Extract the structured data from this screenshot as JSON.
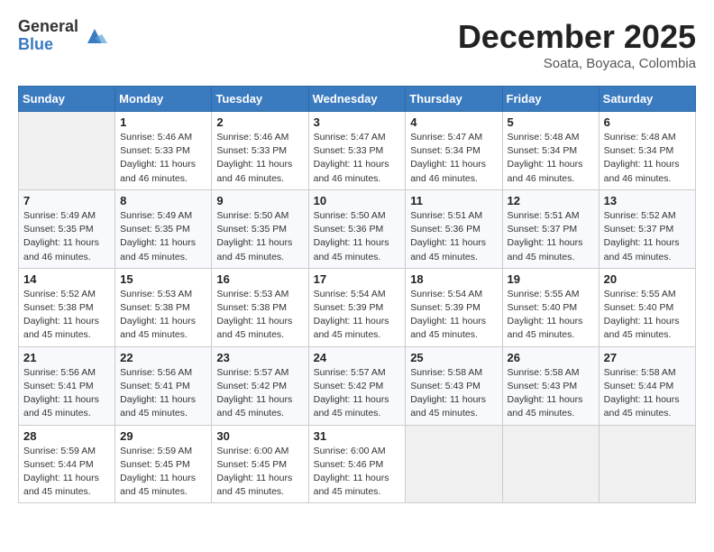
{
  "header": {
    "logo_general": "General",
    "logo_blue": "Blue",
    "month_title": "December 2025",
    "location": "Soata, Boyaca, Colombia"
  },
  "calendar": {
    "weekdays": [
      "Sunday",
      "Monday",
      "Tuesday",
      "Wednesday",
      "Thursday",
      "Friday",
      "Saturday"
    ],
    "weeks": [
      [
        {
          "day": "",
          "info": ""
        },
        {
          "day": "1",
          "info": "Sunrise: 5:46 AM\nSunset: 5:33 PM\nDaylight: 11 hours\nand 46 minutes."
        },
        {
          "day": "2",
          "info": "Sunrise: 5:46 AM\nSunset: 5:33 PM\nDaylight: 11 hours\nand 46 minutes."
        },
        {
          "day": "3",
          "info": "Sunrise: 5:47 AM\nSunset: 5:33 PM\nDaylight: 11 hours\nand 46 minutes."
        },
        {
          "day": "4",
          "info": "Sunrise: 5:47 AM\nSunset: 5:34 PM\nDaylight: 11 hours\nand 46 minutes."
        },
        {
          "day": "5",
          "info": "Sunrise: 5:48 AM\nSunset: 5:34 PM\nDaylight: 11 hours\nand 46 minutes."
        },
        {
          "day": "6",
          "info": "Sunrise: 5:48 AM\nSunset: 5:34 PM\nDaylight: 11 hours\nand 46 minutes."
        }
      ],
      [
        {
          "day": "7",
          "info": "Sunrise: 5:49 AM\nSunset: 5:35 PM\nDaylight: 11 hours\nand 46 minutes."
        },
        {
          "day": "8",
          "info": "Sunrise: 5:49 AM\nSunset: 5:35 PM\nDaylight: 11 hours\nand 45 minutes."
        },
        {
          "day": "9",
          "info": "Sunrise: 5:50 AM\nSunset: 5:35 PM\nDaylight: 11 hours\nand 45 minutes."
        },
        {
          "day": "10",
          "info": "Sunrise: 5:50 AM\nSunset: 5:36 PM\nDaylight: 11 hours\nand 45 minutes."
        },
        {
          "day": "11",
          "info": "Sunrise: 5:51 AM\nSunset: 5:36 PM\nDaylight: 11 hours\nand 45 minutes."
        },
        {
          "day": "12",
          "info": "Sunrise: 5:51 AM\nSunset: 5:37 PM\nDaylight: 11 hours\nand 45 minutes."
        },
        {
          "day": "13",
          "info": "Sunrise: 5:52 AM\nSunset: 5:37 PM\nDaylight: 11 hours\nand 45 minutes."
        }
      ],
      [
        {
          "day": "14",
          "info": "Sunrise: 5:52 AM\nSunset: 5:38 PM\nDaylight: 11 hours\nand 45 minutes."
        },
        {
          "day": "15",
          "info": "Sunrise: 5:53 AM\nSunset: 5:38 PM\nDaylight: 11 hours\nand 45 minutes."
        },
        {
          "day": "16",
          "info": "Sunrise: 5:53 AM\nSunset: 5:38 PM\nDaylight: 11 hours\nand 45 minutes."
        },
        {
          "day": "17",
          "info": "Sunrise: 5:54 AM\nSunset: 5:39 PM\nDaylight: 11 hours\nand 45 minutes."
        },
        {
          "day": "18",
          "info": "Sunrise: 5:54 AM\nSunset: 5:39 PM\nDaylight: 11 hours\nand 45 minutes."
        },
        {
          "day": "19",
          "info": "Sunrise: 5:55 AM\nSunset: 5:40 PM\nDaylight: 11 hours\nand 45 minutes."
        },
        {
          "day": "20",
          "info": "Sunrise: 5:55 AM\nSunset: 5:40 PM\nDaylight: 11 hours\nand 45 minutes."
        }
      ],
      [
        {
          "day": "21",
          "info": "Sunrise: 5:56 AM\nSunset: 5:41 PM\nDaylight: 11 hours\nand 45 minutes."
        },
        {
          "day": "22",
          "info": "Sunrise: 5:56 AM\nSunset: 5:41 PM\nDaylight: 11 hours\nand 45 minutes."
        },
        {
          "day": "23",
          "info": "Sunrise: 5:57 AM\nSunset: 5:42 PM\nDaylight: 11 hours\nand 45 minutes."
        },
        {
          "day": "24",
          "info": "Sunrise: 5:57 AM\nSunset: 5:42 PM\nDaylight: 11 hours\nand 45 minutes."
        },
        {
          "day": "25",
          "info": "Sunrise: 5:58 AM\nSunset: 5:43 PM\nDaylight: 11 hours\nand 45 minutes."
        },
        {
          "day": "26",
          "info": "Sunrise: 5:58 AM\nSunset: 5:43 PM\nDaylight: 11 hours\nand 45 minutes."
        },
        {
          "day": "27",
          "info": "Sunrise: 5:58 AM\nSunset: 5:44 PM\nDaylight: 11 hours\nand 45 minutes."
        }
      ],
      [
        {
          "day": "28",
          "info": "Sunrise: 5:59 AM\nSunset: 5:44 PM\nDaylight: 11 hours\nand 45 minutes."
        },
        {
          "day": "29",
          "info": "Sunrise: 5:59 AM\nSunset: 5:45 PM\nDaylight: 11 hours\nand 45 minutes."
        },
        {
          "day": "30",
          "info": "Sunrise: 6:00 AM\nSunset: 5:45 PM\nDaylight: 11 hours\nand 45 minutes."
        },
        {
          "day": "31",
          "info": "Sunrise: 6:00 AM\nSunset: 5:46 PM\nDaylight: 11 hours\nand 45 minutes."
        },
        {
          "day": "",
          "info": ""
        },
        {
          "day": "",
          "info": ""
        },
        {
          "day": "",
          "info": ""
        }
      ]
    ]
  }
}
